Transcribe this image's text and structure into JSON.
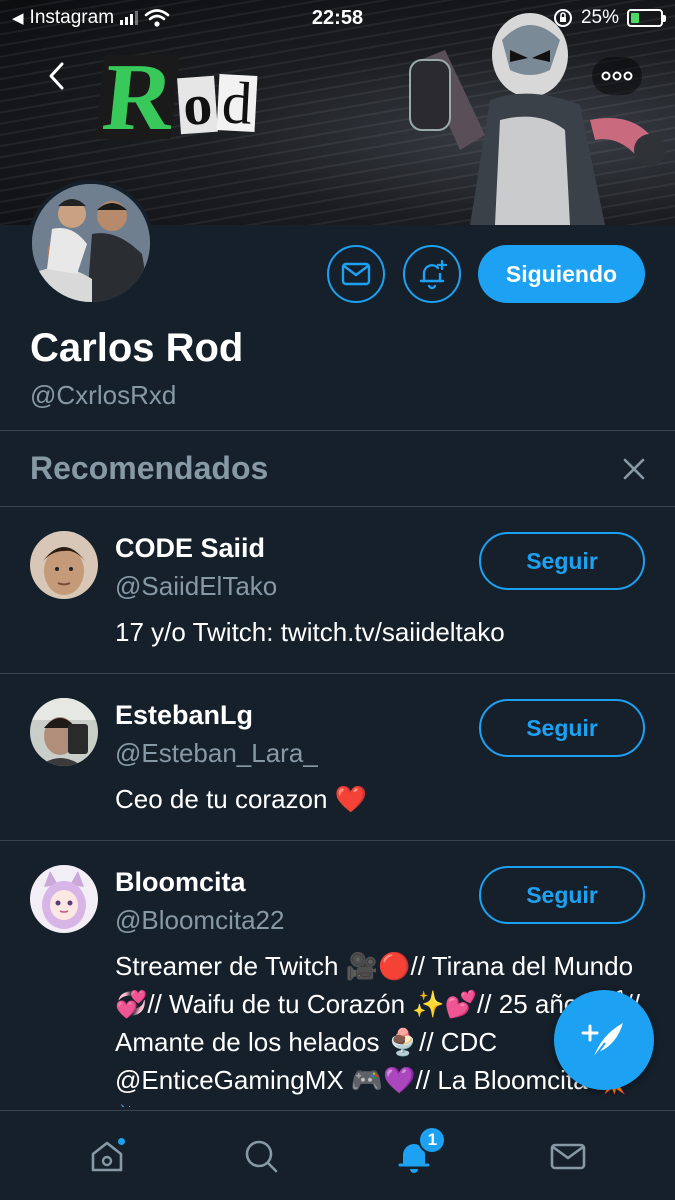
{
  "status_bar": {
    "back_app": "Instagram",
    "time": "22:58",
    "battery": "25%"
  },
  "banner": {
    "logo_big": "R",
    "logo_small_1": "o",
    "logo_small_2": "d"
  },
  "profile": {
    "name": "Carlos Rod",
    "handle": "@CxrlosRxd",
    "following_label": "Siguiendo"
  },
  "recommended": {
    "title": "Recomendados",
    "users": [
      {
        "name": "CODE Saiid",
        "handle": "@SaiidElTako",
        "bio": "17 y/o Twitch: twitch.tv/saiideltako",
        "follow_label": "Seguir"
      },
      {
        "name": "EstebanLg",
        "handle": "@Esteban_Lara_",
        "bio": "Ceo de tu corazon ❤️",
        "follow_label": "Seguir"
      },
      {
        "name": "Bloomcita",
        "handle": "@Bloomcita22",
        "bio": "Streamer de Twitch 🎥🔴// Tirana del Mundo 💞// Waifu de tu Corazón ✨💕// 25 años 🐱// Amante de los helados 🍨// CDC @EnticeGamingMX 🎮💜// La Bloomcita 💥🦄",
        "follow_label": "Seguir"
      }
    ]
  },
  "tabbar": {
    "notifications_badge": "1"
  },
  "colors": {
    "accent": "#1da1f2",
    "background": "#15202b",
    "secondary_text": "#8899a6",
    "divider": "#38444d"
  },
  "icons": [
    "back-arrow-icon",
    "more-dots-icon",
    "mail-icon",
    "bell-plus-icon",
    "close-icon",
    "compose-tweet-icon",
    "home-icon",
    "search-icon",
    "bell-icon",
    "messages-icon"
  ]
}
